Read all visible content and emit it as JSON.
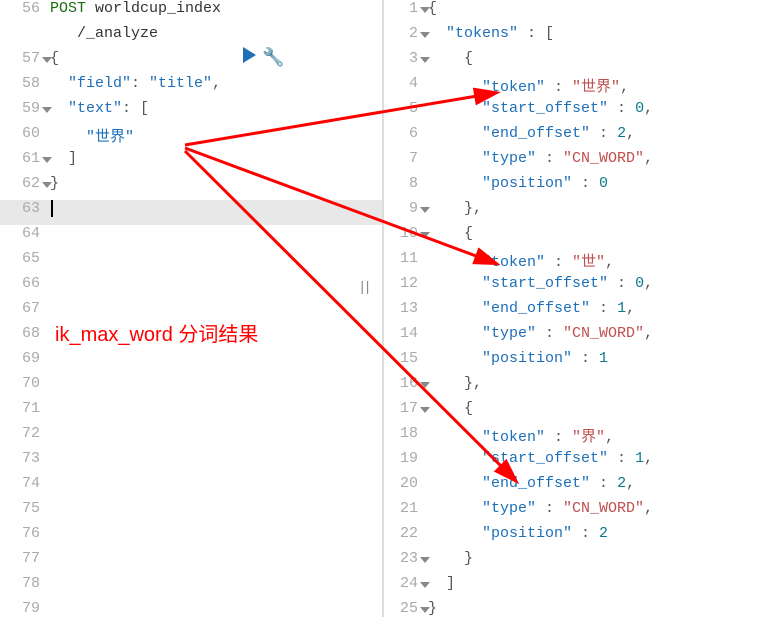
{
  "left": {
    "linesStart": 56,
    "method": "POST",
    "path1": "worldcup_index",
    "path2": "/_analyze",
    "open_brace": "{",
    "field_key": "\"field\"",
    "field_val": "\"title\"",
    "text_key": "\"text\"",
    "text_open": "[",
    "text_item": "\"世界\"",
    "text_close": "]",
    "close_brace": "}",
    "ln56": "56",
    "ln57": "57",
    "ln58": "58",
    "ln59": "59",
    "ln60": "60",
    "ln61": "61",
    "ln62": "62",
    "ln63": "63",
    "ln64": "64",
    "ln65": "65",
    "ln66": "66",
    "ln67": "67",
    "ln68": "68",
    "ln69": "69",
    "ln70": "70",
    "ln71": "71",
    "ln72": "72",
    "ln73": "73",
    "ln74": "74",
    "ln75": "75",
    "ln76": "76",
    "ln77": "77",
    "ln78": "78",
    "ln79": "79"
  },
  "right": {
    "ln1": "1",
    "ln2": "2",
    "ln3": "3",
    "ln4": "4",
    "ln5": "5",
    "ln6": "6",
    "ln7": "7",
    "ln8": "8",
    "ln9": "9",
    "ln10": "10",
    "ln11": "11",
    "ln12": "12",
    "ln13": "13",
    "ln14": "14",
    "ln15": "15",
    "ln16": "16",
    "ln17": "17",
    "ln18": "18",
    "ln19": "19",
    "ln20": "20",
    "ln21": "21",
    "ln22": "22",
    "ln23": "23",
    "ln24": "24",
    "ln25": "25",
    "open": "{",
    "tokens_key": "\"tokens\"",
    "arr_open": "[",
    "obj_open": "{",
    "token_key": "\"token\"",
    "start_key": "\"start_offset\"",
    "end_key": "\"end_offset\"",
    "type_key": "\"type\"",
    "pos_key": "\"position\"",
    "type_val": "\"CN_WORD\"",
    "t1_token": "\"世界\"",
    "t1_start": "0",
    "t1_end": "2",
    "t1_pos": "0",
    "t2_token": "\"世\"",
    "t2_start": "0",
    "t2_end": "1",
    "t2_pos": "1",
    "t3_token": "\"界\"",
    "t3_start": "1",
    "t3_end": "2",
    "t3_pos": "2",
    "obj_close_comma": "},",
    "obj_close": "}",
    "arr_close": "]",
    "close": "}"
  },
  "annotation": "ik_max_word 分词结果",
  "colors": {
    "arrow": "#ff0000"
  },
  "chart_data": {
    "type": "table",
    "title": "ik_max_word tokens for 世界",
    "columns": [
      "token",
      "start_offset",
      "end_offset",
      "type",
      "position"
    ],
    "rows": [
      [
        "世界",
        0,
        2,
        "CN_WORD",
        0
      ],
      [
        "世",
        0,
        1,
        "CN_WORD",
        1
      ],
      [
        "界",
        1,
        2,
        "CN_WORD",
        2
      ]
    ]
  }
}
